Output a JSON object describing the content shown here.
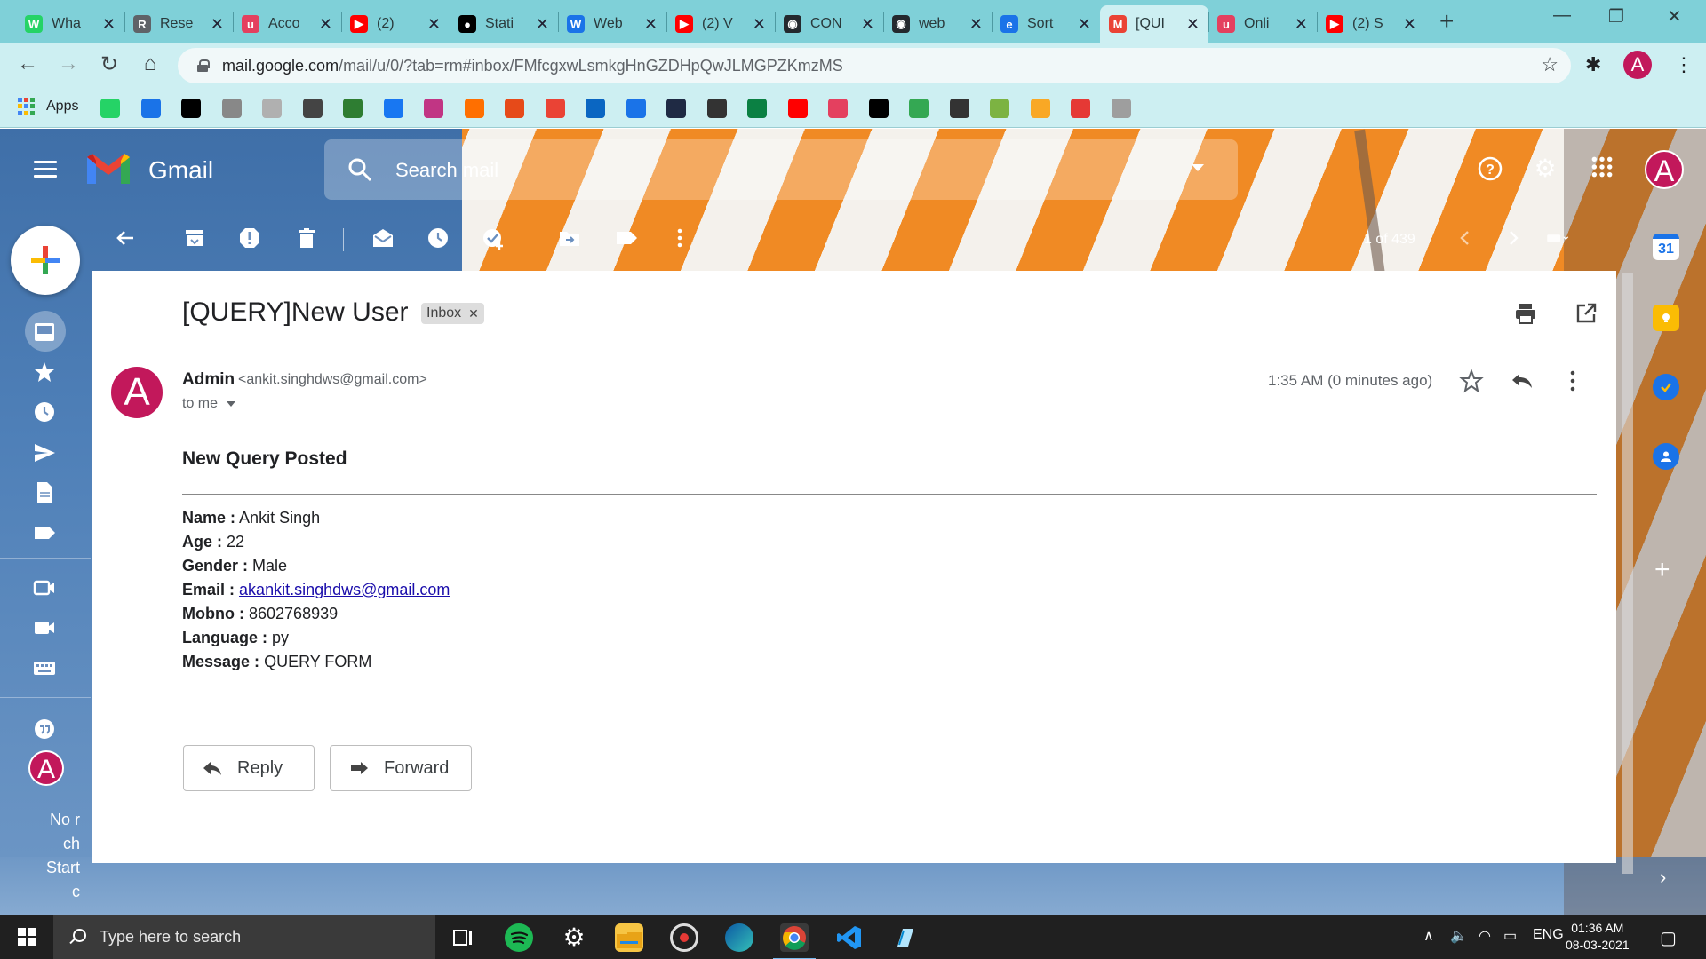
{
  "browser": {
    "tabs": [
      {
        "label": "Wha",
        "color": "#25d366",
        "glyph": "W"
      },
      {
        "label": "Rese",
        "color": "#5f6368",
        "glyph": "R"
      },
      {
        "label": "Acco",
        "color": "#e4405f",
        "glyph": "u"
      },
      {
        "label": "(2)",
        "color": "#ff0000",
        "glyph": "▶"
      },
      {
        "label": "Stati",
        "color": "#000000",
        "glyph": "●"
      },
      {
        "label": "Web",
        "color": "#1a73e8",
        "glyph": "W"
      },
      {
        "label": "(2) V",
        "color": "#ff0000",
        "glyph": "▶"
      },
      {
        "label": "CON",
        "color": "#24292e",
        "glyph": "◉"
      },
      {
        "label": "web",
        "color": "#24292e",
        "glyph": "◉"
      },
      {
        "label": "Sort",
        "color": "#1a73e8",
        "glyph": "e"
      },
      {
        "label": "[QUI",
        "color": "#ea4335",
        "glyph": "M"
      },
      {
        "label": "Onli",
        "color": "#e4405f",
        "glyph": "u"
      },
      {
        "label": "(2) S",
        "color": "#ff0000",
        "glyph": "▶"
      }
    ],
    "active_tab_index": 10,
    "url_host": "mail.google.com",
    "url_path": "/mail/u/0/?tab=rm#inbox/FMfcgxwLsmkgHnGZDHpQwJLMGPZKmzMS",
    "profile_initial": "A",
    "bookmarks_apps_label": "Apps",
    "bookmark_colors": [
      "#25d366",
      "#1a73e8",
      "#000000",
      "#888888",
      "#b0b0b0",
      "#444444",
      "#2e7d32",
      "#1877f2",
      "#c13584",
      "#ff6f00",
      "#e64a19",
      "#ea4335",
      "#0a66c2",
      "#1a73e8",
      "#1f2a44",
      "#333333",
      "#0b8043",
      "#ff0000",
      "#e4405f",
      "#000000",
      "#34a853",
      "#333333",
      "#7cb342",
      "#f9a825",
      "#e53935",
      "#9e9e9e"
    ]
  },
  "gmail": {
    "app_name": "Gmail",
    "search_placeholder": "Search mail",
    "pager_text": "1 of 439",
    "account_initial": "A",
    "leftnav_footer": [
      "No r",
      "ch",
      "Start",
      "c"
    ]
  },
  "email": {
    "subject": "[QUERY]New User",
    "label_chip": "Inbox",
    "sender_initial": "A",
    "sender_name": "Admin",
    "sender_email": "<ankit.singhdws@gmail.com>",
    "recipient": "to me",
    "timestamp": "1:35 AM (0 minutes ago)",
    "heading": "New Query Posted",
    "fields": [
      {
        "label": "Name :",
        "value": "Ankit Singh"
      },
      {
        "label": "Age :",
        "value": "22"
      },
      {
        "label": "Gender :",
        "value": "Male"
      },
      {
        "label": "Email :",
        "value": "akankit.singhdws@gmail.com",
        "link": true
      },
      {
        "label": "Mobno :",
        "value": "8602768939"
      },
      {
        "label": "Language :",
        "value": "py"
      },
      {
        "label": "Message :",
        "value": "QUERY FORM"
      }
    ],
    "reply_label": "Reply",
    "forward_label": "Forward"
  },
  "taskbar": {
    "search_placeholder": "Type here to search",
    "language": "ENG",
    "time": "01:36 AM",
    "date": "08-03-2021"
  },
  "colors": {
    "accent_avatar": "#c2185b",
    "chrome_tabstrip": "#7fd0d8",
    "chrome_toolbar": "#cdeff2"
  }
}
